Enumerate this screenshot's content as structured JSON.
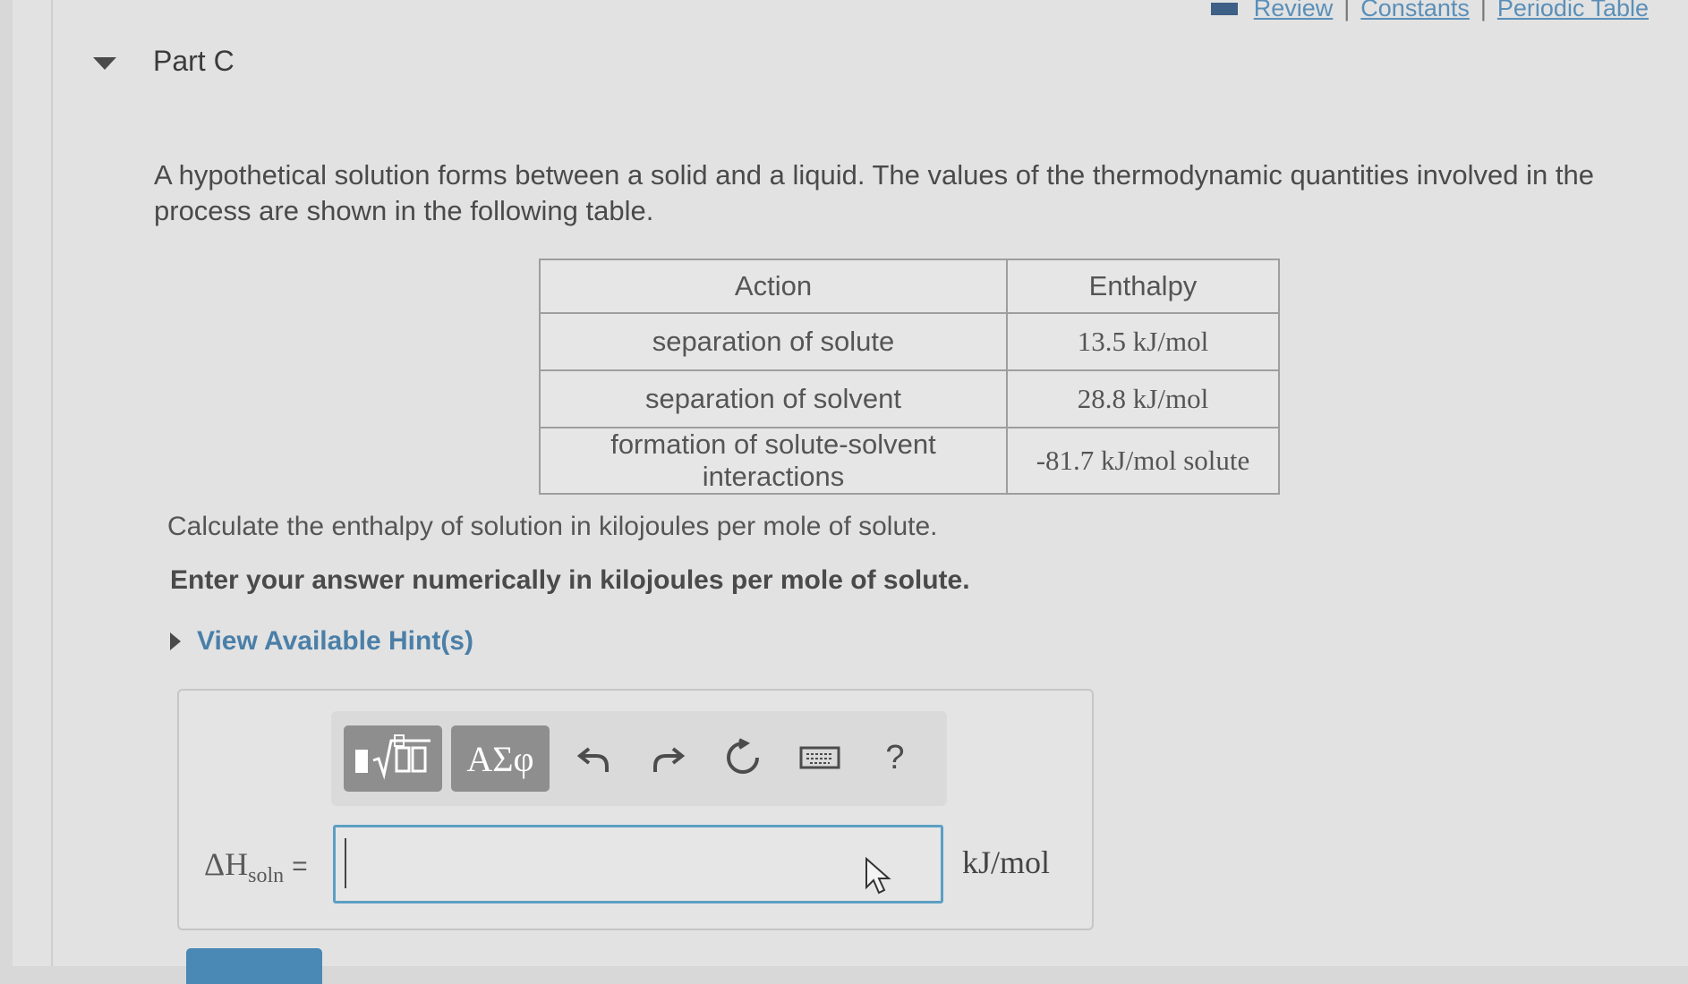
{
  "header": {
    "links": [
      "Review",
      "Constants",
      "Periodic Table"
    ],
    "separator": "|"
  },
  "part": {
    "title": "Part C"
  },
  "problem": {
    "intro": "A hypothetical solution forms between a solid and a liquid.  The values of the thermodynamic quantities involved in the process are shown in the following table.",
    "table": {
      "headers": [
        "Action",
        "Enthalpy"
      ],
      "rows": [
        {
          "action": "separation of solute",
          "enthalpy": "13.5 kJ/mol"
        },
        {
          "action": "separation of solvent",
          "enthalpy": "28.8 kJ/mol"
        },
        {
          "action": "formation of solute-solvent interactions",
          "enthalpy": "-81.7 kJ/mol solute"
        }
      ]
    },
    "question": "Calculate the enthalpy of solution in kilojoules per mole of solute.",
    "instruction": "Enter your answer numerically in kilojoules per mole of solute.",
    "hint_link": "View Available Hint(s)"
  },
  "answer": {
    "toolbar": {
      "greek_label": "ΑΣφ",
      "help_label": "?"
    },
    "label_main": "ΔH",
    "label_sub": "soln",
    "label_eq": "=",
    "value": "",
    "unit": "kJ/mol"
  },
  "colors": {
    "accent": "#5c9fc4",
    "link": "#4a7fa8",
    "button_gray": "#8e8e8e"
  }
}
